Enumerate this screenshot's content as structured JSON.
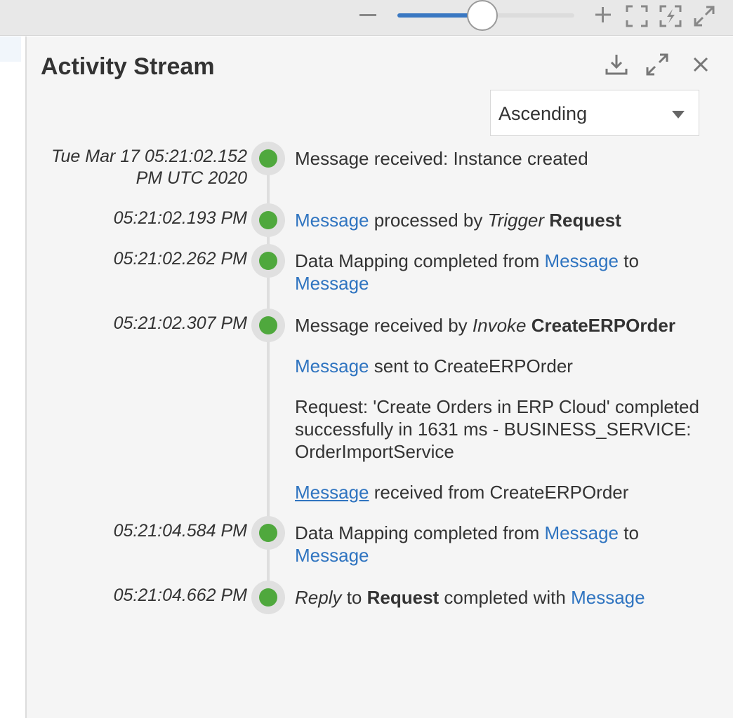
{
  "panel": {
    "title": "Activity Stream",
    "sort": {
      "selected": "Ascending"
    }
  },
  "icons": {
    "zoom_out": "minus-icon",
    "zoom_in": "plus-icon",
    "fit": "fit-screen-icon",
    "refresh": "refresh-fit-icon",
    "expand": "expand-icon",
    "download": "download-icon",
    "maximize": "maximize-icon",
    "close": "close-icon"
  },
  "zoom": {
    "level_fraction": 0.48
  },
  "colors": {
    "accent": "#3a78c2",
    "link": "#2f74c0",
    "status_ok": "#4fa83d"
  },
  "entries": [
    {
      "timestamp": "Tue Mar 17 05:21:02.152\nPM UTC 2020",
      "text": "Message received: Instance created"
    },
    {
      "timestamp": "05:21:02.193 PM",
      "link": "Message",
      "text": " processed by ",
      "italic": "Trigger",
      "bold": "Request"
    },
    {
      "timestamp": "05:21:02.262 PM",
      "text_a": "Data Mapping completed from ",
      "link_a": "Message",
      "text_b": " to ",
      "link_b": "Message"
    },
    {
      "timestamp": "05:21:02.307 PM",
      "p1_text": "Message received by ",
      "p1_italic": "Invoke",
      "p1_bold": "CreateERPOrder",
      "p2_link": "Message",
      "p2_text": " sent to CreateERPOrder",
      "p3_text": "Request: 'Create Orders in ERP Cloud' completed successfully in 1631 ms - BUSINESS_SERVICE: OrderImportService",
      "p4_link": "Message",
      "p4_text": " received from CreateERPOrder"
    },
    {
      "timestamp": "05:21:04.584 PM",
      "text_a": "Data Mapping completed from ",
      "link_a": "Message",
      "text_b": " to ",
      "link_b": "Message"
    },
    {
      "timestamp": "05:21:04.662 PM",
      "italic": "Reply",
      "text_a": " to ",
      "bold": "Request",
      "text_b": " completed with ",
      "link": "Message"
    }
  ]
}
